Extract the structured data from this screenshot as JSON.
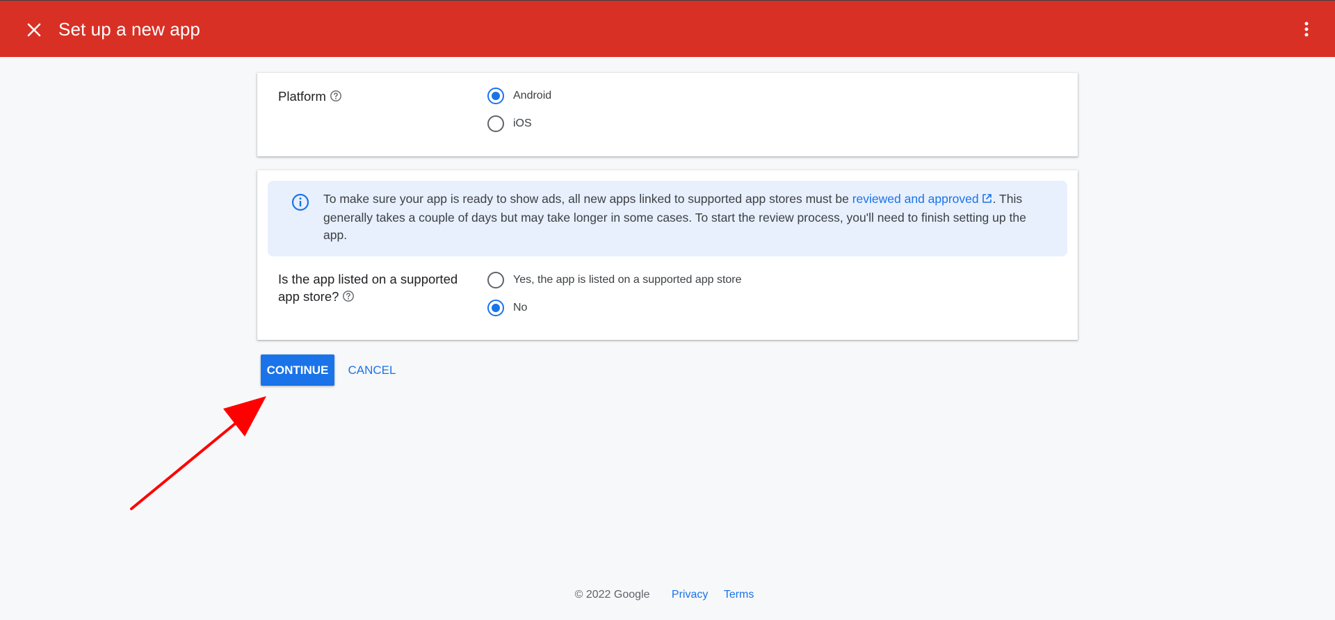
{
  "header": {
    "title": "Set up a new app",
    "close_icon": "close-icon",
    "menu_icon": "more-vert-icon",
    "background_color": "#d93025"
  },
  "platform": {
    "label": "Platform",
    "options": [
      {
        "label": "Android",
        "selected": true
      },
      {
        "label": "iOS",
        "selected": false
      }
    ]
  },
  "review_notice": {
    "text_before_link": "To make sure your app is ready to show ads, all new apps linked to supported app stores must be ",
    "link_text": "reviewed and approved",
    "text_after_link": ". This generally takes a couple of days but may take longer in some cases. To start the review process, you'll need to finish setting up the app."
  },
  "app_store": {
    "label": "Is the app listed on a supported app store?",
    "options": [
      {
        "label": "Yes, the app is listed on a supported app store",
        "selected": false
      },
      {
        "label": "No",
        "selected": true
      }
    ]
  },
  "actions": {
    "continue_label": "CONTINUE",
    "cancel_label": "CANCEL"
  },
  "footer": {
    "copyright": "© 2022 Google",
    "privacy": "Privacy",
    "terms": "Terms"
  },
  "colors": {
    "accent": "#1a73e8",
    "info_background": "#e8f0fe",
    "annotation_arrow": "#ff0000"
  }
}
